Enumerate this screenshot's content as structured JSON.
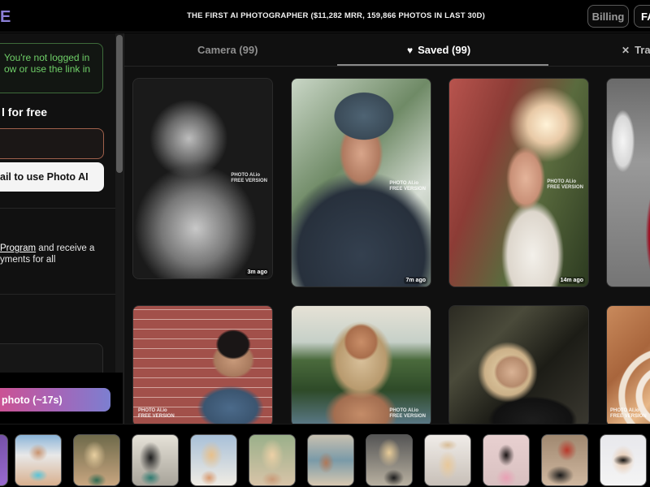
{
  "header": {
    "logo_fragment": "E",
    "tagline": "THE FIRST AI PHOTOGRAPHER ($11,282 MRR, 159,866 PHOTOS IN LAST 30D)",
    "billing_label": "Billing",
    "faq_label": "FAQ"
  },
  "sidebar": {
    "notice_line1": "You're not logged in",
    "notice_line2": "ow or use the link in",
    "signup_title": "l for free",
    "email_value": "",
    "email_placeholder": "",
    "login_button": "ail to use Photo AI",
    "affiliate_link": "Program",
    "affiliate_text1": " and receive a",
    "affiliate_text2": "yments for all"
  },
  "generate": {
    "label": "photo (~17s)"
  },
  "tabs": [
    {
      "label": "Camera (99)",
      "icon": "",
      "active": false
    },
    {
      "label": "Saved (99)",
      "icon": "heart-icon",
      "active": true
    },
    {
      "label": "Tra",
      "icon": "close-icon",
      "active": false
    }
  ],
  "tab_icons": {
    "saved": "♥",
    "trash": "✕"
  },
  "photos": [
    {
      "subject": "black and white shirtless man portrait",
      "watermark": "PHOTO AI.io FREE VERSION",
      "time": "3m ago"
    },
    {
      "subject": "bearded man in grey beanie",
      "watermark": "PHOTO AI.io FREE VERSION",
      "time": "7m ago"
    },
    {
      "subject": "woman in white dress with bokeh lights",
      "watermark": "PHOTO AI.io FREE VERSION",
      "time": "14m ago"
    },
    {
      "subject": "woman in red sweater",
      "watermark": "",
      "time": ""
    },
    {
      "subject": "man in denim jacket against brick wall",
      "watermark": "PHOTO AI.io FREE VERSION",
      "time": ""
    },
    {
      "subject": "woman with choker by pool",
      "watermark": "PHOTO AI.io FREE VERSION",
      "time": ""
    },
    {
      "subject": "blonde woman in forest",
      "watermark": "",
      "time": ""
    },
    {
      "subject": "ring light portrait",
      "watermark": "PHOTO AI.io FREE VERSION",
      "time": ""
    }
  ],
  "watermark": {
    "line1": "PHOTO AI.io",
    "line2": "FREE VERSION"
  },
  "filmstrip": {
    "count": 12
  }
}
